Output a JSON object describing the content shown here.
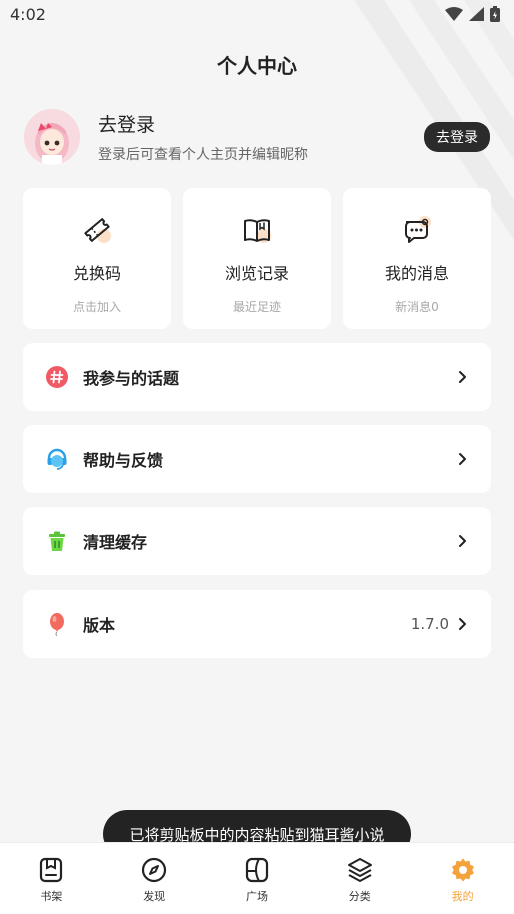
{
  "status_bar": {
    "time": "4:02"
  },
  "header": {
    "title": "个人中心"
  },
  "profile": {
    "name": "去登录",
    "subtitle": "登录后可查看个人主页并编辑昵称",
    "login_button": "去登录"
  },
  "quick_actions": [
    {
      "icon": "ticket-icon",
      "label": "兑换码",
      "sub": "点击加入"
    },
    {
      "icon": "book-icon",
      "label": "浏览记录",
      "sub": "最近足迹"
    },
    {
      "icon": "message-icon",
      "label": "我的消息",
      "sub": "新消息0"
    }
  ],
  "menu": [
    {
      "icon": "hashtag-icon",
      "label": "我参与的话题",
      "value": ""
    },
    {
      "icon": "headset-icon",
      "label": "帮助与反馈",
      "value": ""
    },
    {
      "icon": "trash-icon",
      "label": "清理缓存",
      "value": ""
    },
    {
      "icon": "balloon-icon",
      "label": "版本",
      "value": "1.7.0"
    }
  ],
  "toast": {
    "text": "已将剪贴板中的内容粘贴到猫耳酱小说"
  },
  "tabbar": {
    "items": [
      {
        "icon": "bookshelf-icon",
        "label": "书架"
      },
      {
        "icon": "compass-icon",
        "label": "发现"
      },
      {
        "icon": "plaza-icon",
        "label": "广场"
      },
      {
        "icon": "layers-icon",
        "label": "分类"
      },
      {
        "icon": "gear-icon",
        "label": "我的"
      }
    ],
    "active": "我的"
  },
  "colors": {
    "accent": "#f4a23c",
    "dark_button": "#2b2b2b",
    "background": "#f5f5f5"
  }
}
